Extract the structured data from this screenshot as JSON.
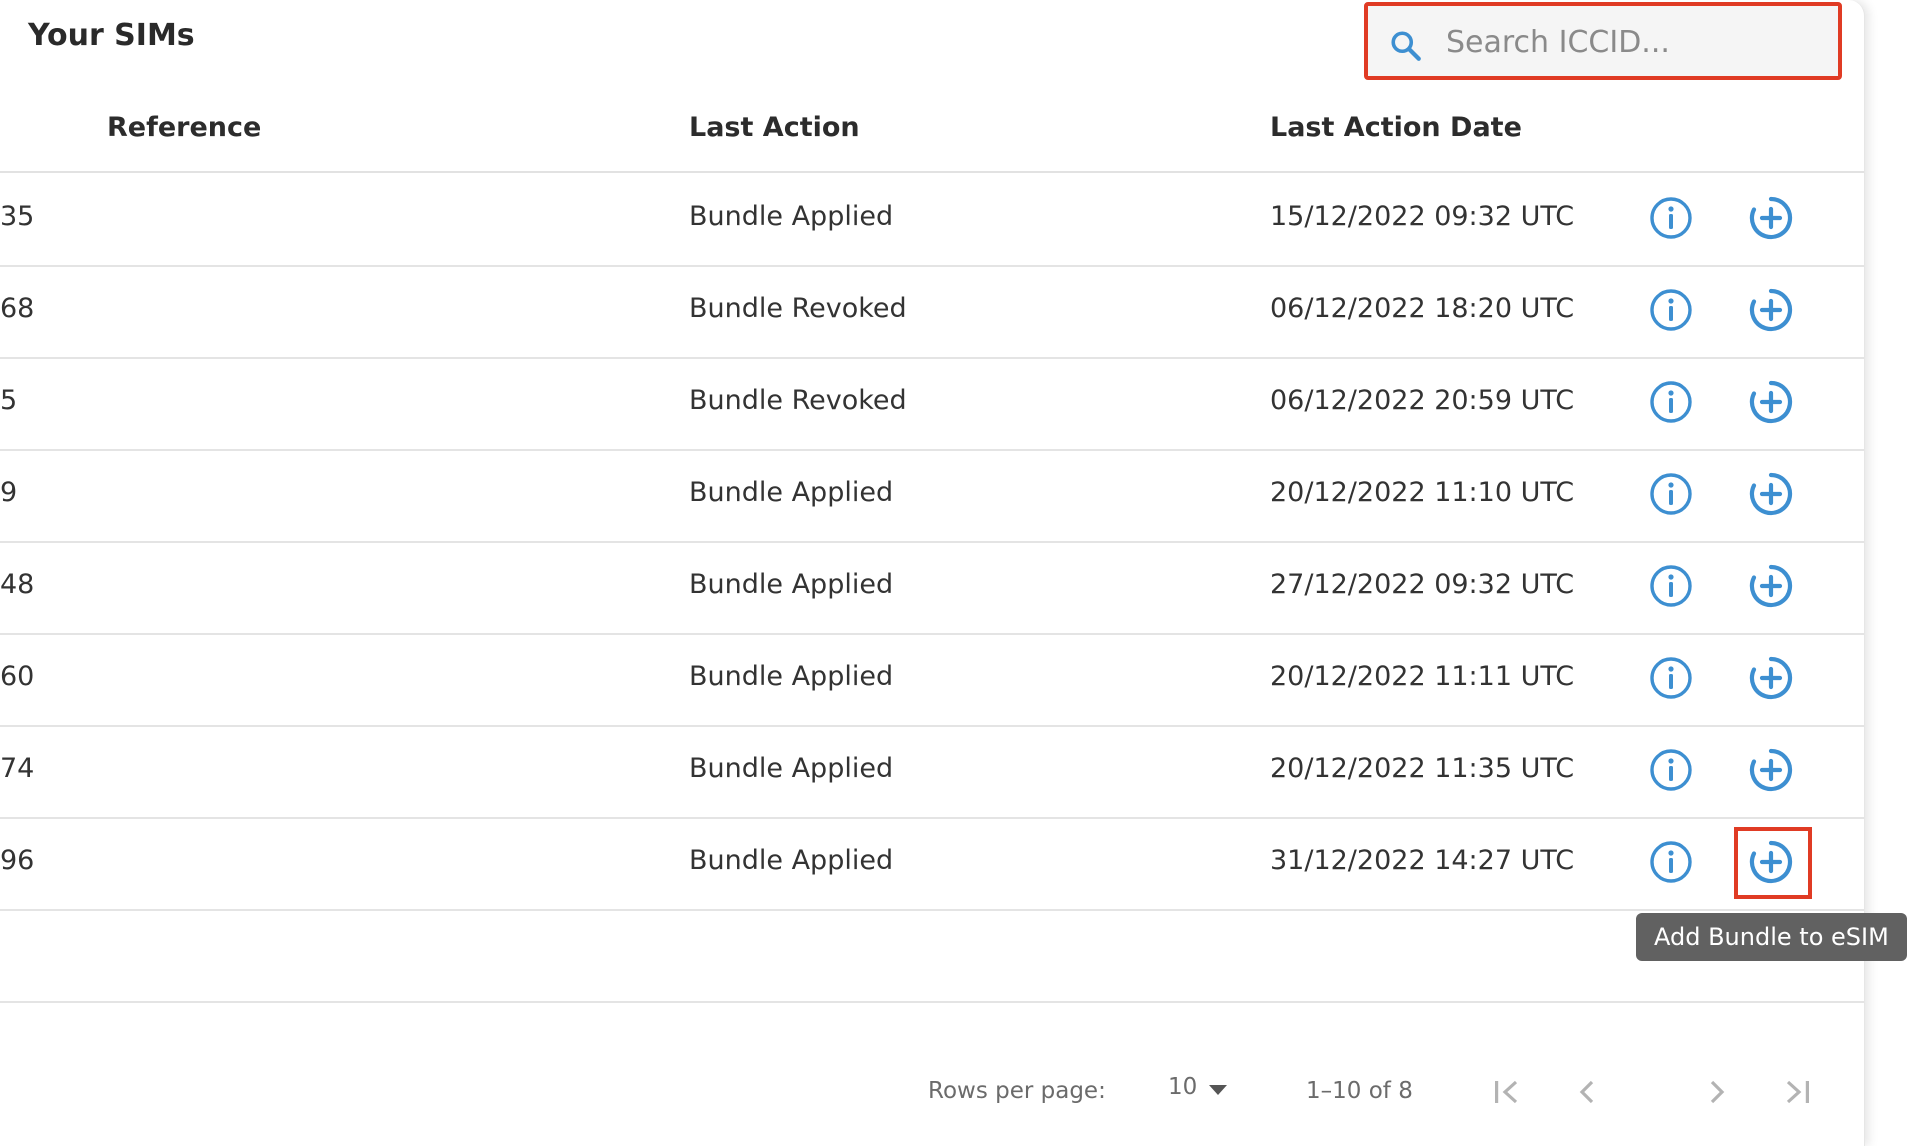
{
  "header": {
    "title": "Your SIMs"
  },
  "search": {
    "placeholder": "Search ICCID..."
  },
  "table": {
    "columns": [
      "Reference",
      "Last Action",
      "Last Action Date"
    ],
    "rows": [
      {
        "reference": "35",
        "last_action": "Bundle Applied",
        "last_action_date": "15/12/2022 09:32 UTC"
      },
      {
        "reference": "68",
        "last_action": "Bundle Revoked",
        "last_action_date": "06/12/2022 18:20 UTC"
      },
      {
        "reference": "5",
        "last_action": "Bundle Revoked",
        "last_action_date": "06/12/2022 20:59 UTC"
      },
      {
        "reference": "9",
        "last_action": "Bundle Applied",
        "last_action_date": "20/12/2022 11:10 UTC"
      },
      {
        "reference": "48",
        "last_action": "Bundle Applied",
        "last_action_date": "27/12/2022 09:32 UTC"
      },
      {
        "reference": "60",
        "last_action": "Bundle Applied",
        "last_action_date": "20/12/2022 11:11 UTC"
      },
      {
        "reference": "74",
        "last_action": "Bundle Applied",
        "last_action_date": "20/12/2022 11:35 UTC"
      },
      {
        "reference": "96",
        "last_action": "Bundle Applied",
        "last_action_date": "31/12/2022 14:27 UTC"
      }
    ]
  },
  "tooltip": {
    "text": "Add Bundle to eSIM"
  },
  "pagination": {
    "rows_per_page_label": "Rows per page:",
    "rows_per_page_value": "10",
    "range_text": "1–10 of 8"
  },
  "icons": {
    "search": "search-icon",
    "info": "info-icon",
    "add_bundle": "add-circle-icon",
    "dropdown": "caret-down-icon",
    "first_page": "first-page-icon",
    "prev_page": "chevron-left-icon",
    "next_page": "chevron-right-icon",
    "last_page": "last-page-icon"
  },
  "colors": {
    "accent": "#3d8fd1",
    "highlight": "#e03b24",
    "tooltip_bg": "#616161"
  }
}
